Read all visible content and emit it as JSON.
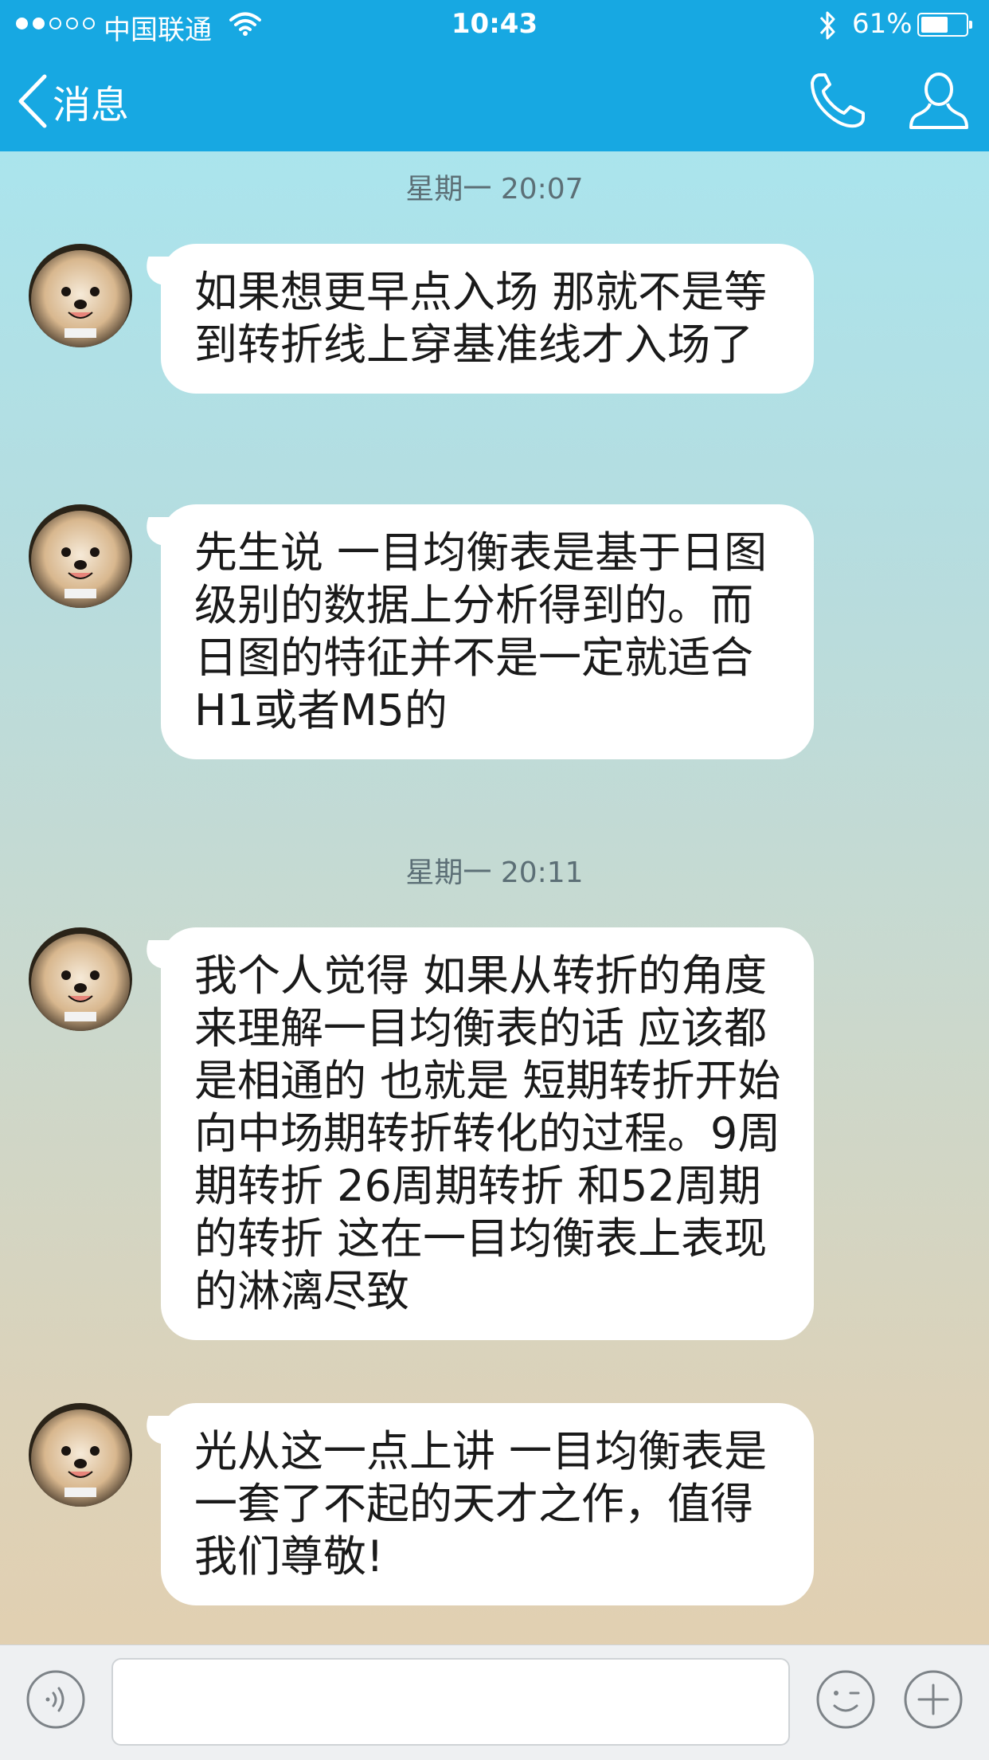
{
  "status_bar": {
    "carrier": "中国联通",
    "time": "10:43",
    "battery_percent": "61%",
    "battery_level": 0.61,
    "signal_strength": 2,
    "signal_max": 5
  },
  "nav": {
    "back_label": "消息",
    "icons": [
      "back-chevron-icon",
      "phone-icon",
      "profile-icon"
    ]
  },
  "messages": [
    {
      "timestamp": "星期一 20:07",
      "text": "如果想更早点入场 那就不是等到转折线上穿基准线才入场了"
    },
    {
      "text": "先生说 一目均衡表是基于日图级别的数据上分析得到的。而日图的特征并不是一定就适合H1或者M5的"
    },
    {
      "timestamp": "星期一 20:11",
      "text": "我个人觉得 如果从转折的角度来理解一目均衡表的话 应该都是相通的 也就是 短期转折开始向中场期转折转化的过程。9周期转折 26周期转折 和52周期的转折 这在一目均衡表上表现的淋漓尽致"
    },
    {
      "text": "光从这一点上讲 一目均衡表是一套了不起的天才之作，值得我们尊敬!"
    }
  ],
  "input_bar": {
    "icons": [
      "voice-icon",
      "emoji-icon",
      "plus-icon"
    ]
  },
  "colors": {
    "header": "#17a8e2",
    "bubble": "#ffffff",
    "timestamp": "#5c6f76"
  }
}
